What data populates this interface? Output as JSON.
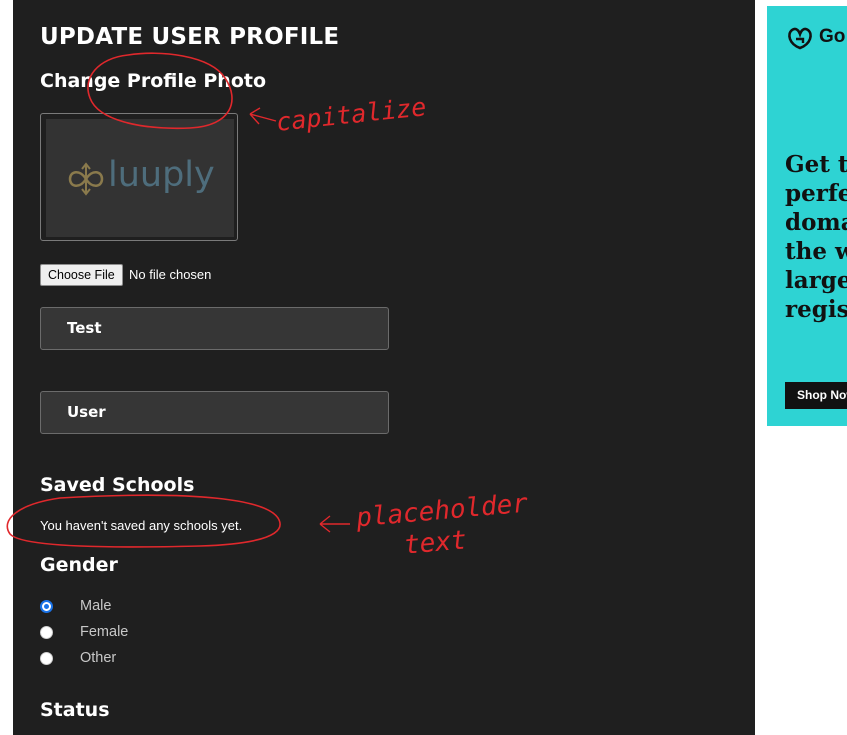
{
  "page": {
    "title": "UPDATE USER PROFILE",
    "photo_section_title": "Change Profile Photo",
    "photo_logo_text": "luuply",
    "choose_file_label": "Choose File",
    "file_status": "No file chosen",
    "first_name_value": "Test",
    "last_name_value": "User",
    "schools_title": "Saved Schools",
    "schools_empty_text": "You haven't saved any schools yet.",
    "gender_title": "Gender",
    "gender_options": [
      {
        "label": "Male",
        "checked": true
      },
      {
        "label": "Female",
        "checked": false
      },
      {
        "label": "Other",
        "checked": false
      }
    ],
    "status_title": "Status"
  },
  "ad": {
    "brand": "Go",
    "headline_lines": [
      "Get th",
      "perfe",
      "doma",
      "the w",
      "large",
      "regis"
    ],
    "cta": "Shop Now",
    "background_color": "#2ed3d3"
  },
  "annotations": {
    "capitalize_note": "capitalize",
    "placeholder_note_line1": "placeholder",
    "placeholder_note_line2": "text",
    "color": "#e0282c"
  }
}
